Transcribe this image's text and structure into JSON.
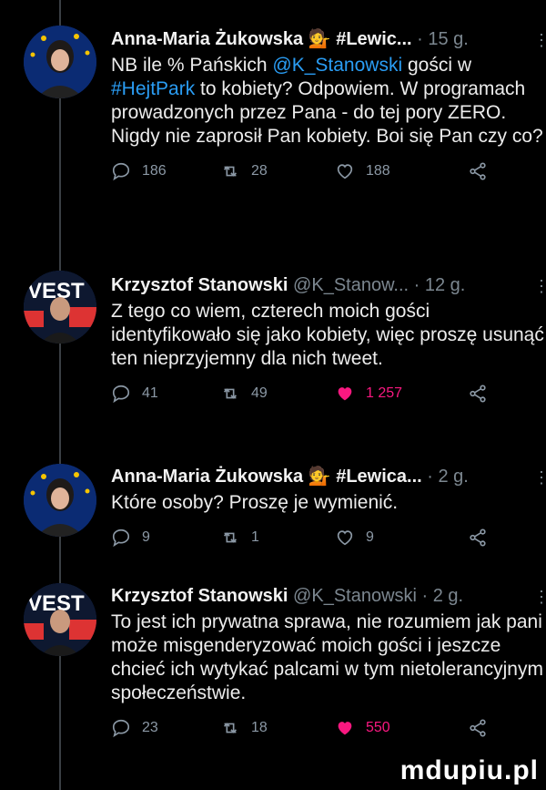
{
  "tweets": [
    {
      "name": "Anna-Maria Żukowska",
      "emoji": "💁",
      "handle": "#Lewic...",
      "time": "· 15 g.",
      "body": [
        {
          "t": "NB ile % Pańskich "
        },
        {
          "t": "@K_Stanowski",
          "link": true
        },
        {
          "t": " gości w "
        },
        {
          "t": "#HejtPark",
          "link": true
        },
        {
          "t": " to kobiety? Odpowiem. W programach prowadzonych przez Pana - do tej pory ZERO. Nigdy nie zaprosił Pan kobiety. Boi się Pan czy co?"
        }
      ],
      "replies": "186",
      "retweets": "28",
      "likes": "188",
      "liked": false
    },
    {
      "name": "Krzysztof Stanowski",
      "emoji": "",
      "handle": "@K_Stanow...",
      "time": "· 12 g.",
      "body": [
        {
          "t": "Z tego co wiem, czterech moich gości identyfikowało się jako kobiety, więc proszę usunąć ten nieprzyjemny dla nich tweet."
        }
      ],
      "replies": "41",
      "retweets": "49",
      "likes": "1 257",
      "liked": true
    },
    {
      "name": "Anna-Maria Żukowska",
      "emoji": "💁",
      "handle": "#Lewica...",
      "time": "· 2 g.",
      "body": [
        {
          "t": "Które osoby? Proszę je wymienić."
        }
      ],
      "replies": "9",
      "retweets": "1",
      "likes": "9",
      "liked": false
    },
    {
      "name": "Krzysztof Stanowski",
      "emoji": "",
      "handle": "@K_Stanowski",
      "time": "· 2 g.",
      "body": [
        {
          "t": "To jest ich prywatna sprawa, nie rozumiem jak pani może misgenderyzować moich gości i jeszcze chcieć ich wytykać palcami w tym nietolerancyjnym społeczeństwie."
        }
      ],
      "replies": "23",
      "retweets": "18",
      "likes": "550",
      "liked": true
    }
  ],
  "watermark": "mdupiu.pl",
  "colors": {
    "link": "#2a9df4",
    "like": "#f91880",
    "muted": "#7c8790"
  }
}
